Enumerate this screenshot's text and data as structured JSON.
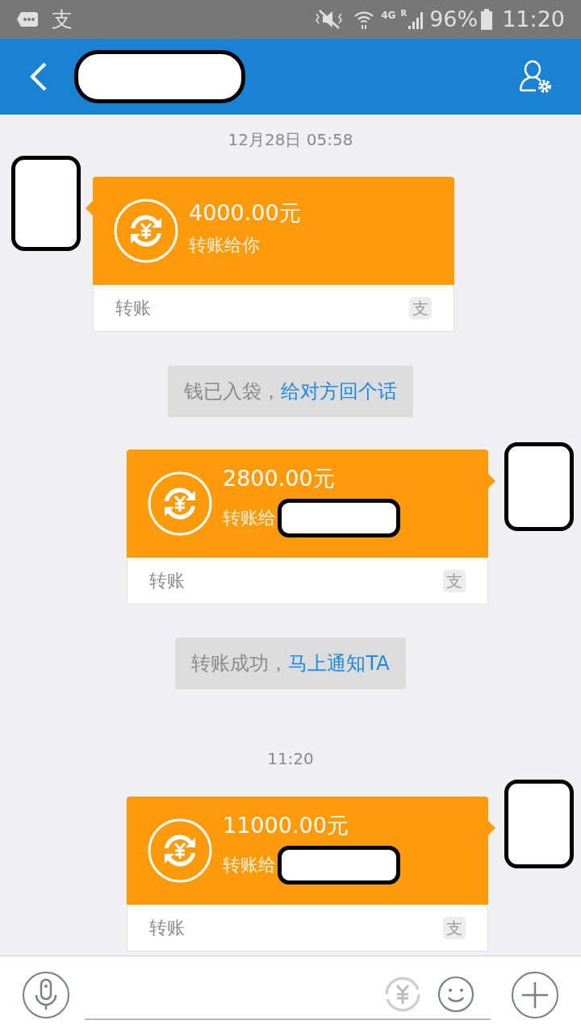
{
  "status_bar": {
    "app_glyph": "支",
    "network": "4G",
    "roaming": "R",
    "battery": "96%",
    "time": "11:20"
  },
  "header": {
    "title_redacted": true
  },
  "messages": [
    {
      "kind": "time",
      "text": "12月28日 05:58"
    },
    {
      "kind": "transfer",
      "outgoing": false,
      "amount": "4000.00元",
      "subtitle": "转账给你",
      "recipient_redacted": false,
      "footer": "转账",
      "logo": "支"
    },
    {
      "kind": "notice",
      "text": "钱已入袋，",
      "link": "给对方回个话"
    },
    {
      "kind": "transfer",
      "outgoing": true,
      "amount": "2800.00元",
      "subtitle": "转账给",
      "recipient_redacted": true,
      "footer": "转账",
      "logo": "支"
    },
    {
      "kind": "notice",
      "text": "转账成功，",
      "link": "马上通知TA"
    },
    {
      "kind": "time",
      "text": "11:20"
    },
    {
      "kind": "transfer",
      "outgoing": true,
      "amount": "11000.00元",
      "subtitle": "转账给",
      "recipient_redacted": true,
      "footer": "转账",
      "logo": "支"
    }
  ]
}
